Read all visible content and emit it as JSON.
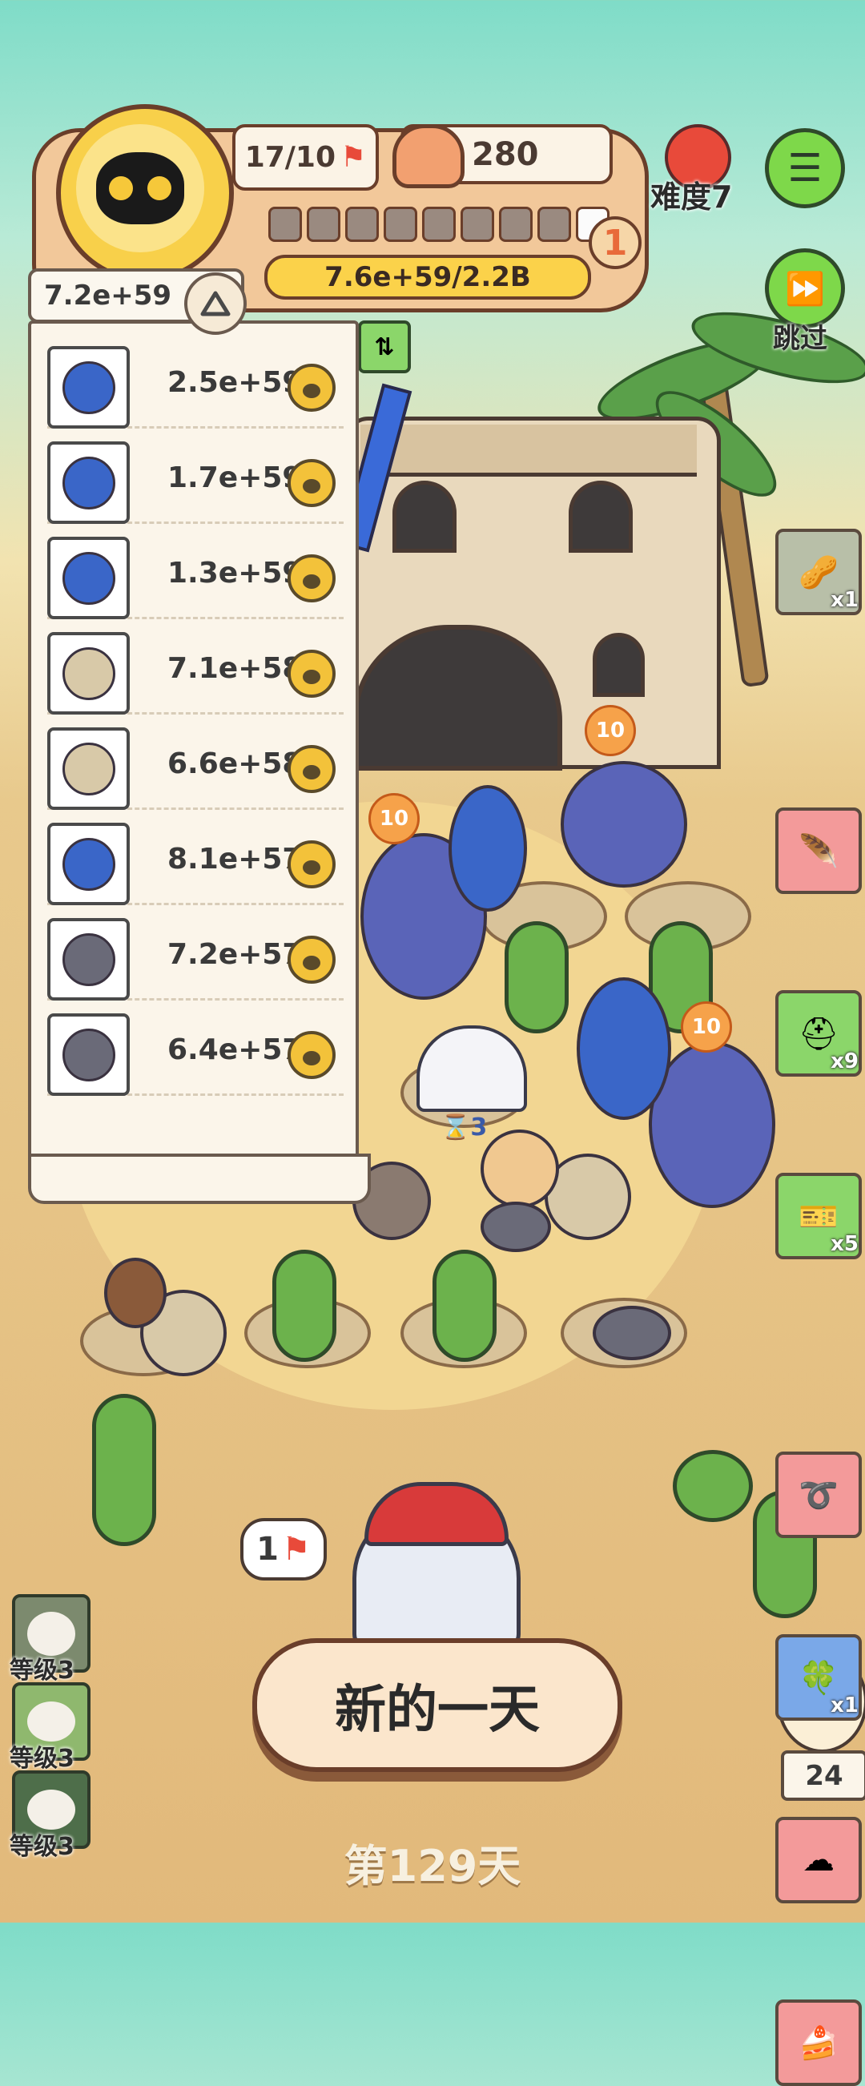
{
  "hud": {
    "flags": "17/10",
    "food_count": "280",
    "difficulty": "难度7",
    "progress_text": "7.6e+59/2.2B",
    "level": "1",
    "segments_total": 9,
    "segments_filled": 1,
    "skip_label": "跳过"
  },
  "ranking": {
    "score": "7.2e+59",
    "rows": [
      {
        "animal": "peacock",
        "value": "2.5e+59"
      },
      {
        "animal": "peacock",
        "value": "1.7e+59"
      },
      {
        "animal": "peacock",
        "value": "1.3e+59"
      },
      {
        "animal": "hedgehog",
        "value": "7.1e+58"
      },
      {
        "animal": "hedgehog",
        "value": "6.6e+58"
      },
      {
        "animal": "peacock",
        "value": "8.1e+57"
      },
      {
        "animal": "rat",
        "value": "7.2e+57"
      },
      {
        "animal": "rat",
        "value": "6.4e+57"
      }
    ]
  },
  "field": {
    "badges": [
      "10",
      "10",
      "10"
    ],
    "igloo_timer": "3"
  },
  "side_items": [
    {
      "name": "nuts",
      "count": "x1"
    },
    {
      "name": "feather",
      "count": ""
    },
    {
      "name": "helmet",
      "count": "x9"
    },
    {
      "name": "ticket",
      "count": "x5"
    },
    {
      "name": "rope",
      "count": ""
    },
    {
      "name": "charm",
      "count": "x1"
    },
    {
      "name": "cloud",
      "count": ""
    },
    {
      "name": "cake",
      "count": ""
    }
  ],
  "level_buttons": [
    "等级3",
    "等级3",
    "等级3"
  ],
  "flag_bubble": "1",
  "new_day_label": "新的一天",
  "day_label": "第129天",
  "chick_counter": "24",
  "colors": {
    "accent_green": "#7ed84a",
    "hud_orange": "#f2c89a",
    "button_cream": "#fbe6cc"
  }
}
